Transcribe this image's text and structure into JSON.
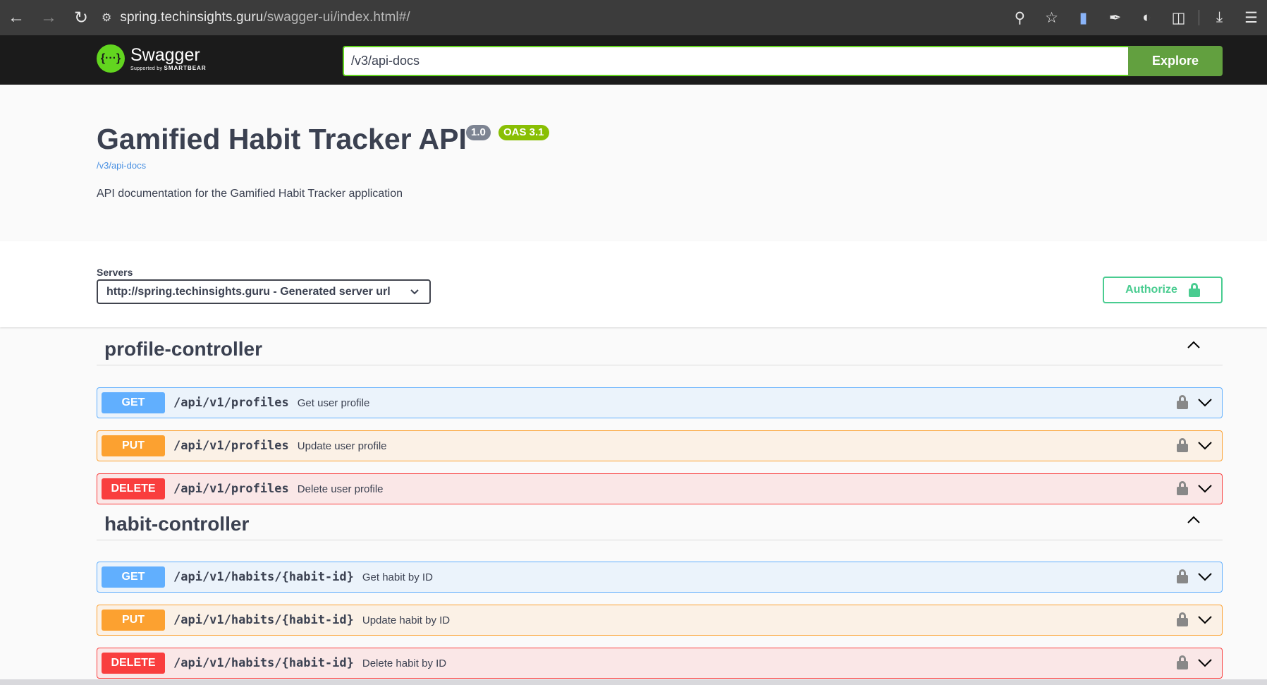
{
  "browser": {
    "url_host": "spring.techinsights.guru",
    "url_path": "/swagger-ui/index.html#/"
  },
  "topbar": {
    "logo_name": "Swagger",
    "logo_sub_prefix": "Supported by ",
    "logo_sub_brand": "SMARTBEAR",
    "spec_url": "/v3/api-docs",
    "explore_label": "Explore"
  },
  "info": {
    "title": "Gamified Habit Tracker API",
    "version": "1.0",
    "oas": "OAS 3.1",
    "doc_link": "/v3/api-docs",
    "description": "API documentation for the Gamified Habit Tracker application"
  },
  "servers": {
    "label": "Servers",
    "selected": "http://spring.techinsights.guru - Generated server url",
    "authorize_label": "Authorize"
  },
  "tags": [
    {
      "name": "profile-controller",
      "operations": [
        {
          "method": "GET",
          "path": "/api/v1/profiles",
          "summary": "Get user profile"
        },
        {
          "method": "PUT",
          "path": "/api/v1/profiles",
          "summary": "Update user profile"
        },
        {
          "method": "DELETE",
          "path": "/api/v1/profiles",
          "summary": "Delete user profile"
        }
      ]
    },
    {
      "name": "habit-controller",
      "operations": [
        {
          "method": "GET",
          "path": "/api/v1/habits/{habit-id}",
          "summary": "Get habit by ID"
        },
        {
          "method": "PUT",
          "path": "/api/v1/habits/{habit-id}",
          "summary": "Update habit by ID"
        },
        {
          "method": "DELETE",
          "path": "/api/v1/habits/{habit-id}",
          "summary": "Delete habit by ID"
        }
      ]
    }
  ],
  "colors": {
    "get": "#61affe",
    "put": "#fca130",
    "delete": "#f93e3e",
    "brand_green": "#62d51f",
    "authorize": "#49cc90"
  }
}
